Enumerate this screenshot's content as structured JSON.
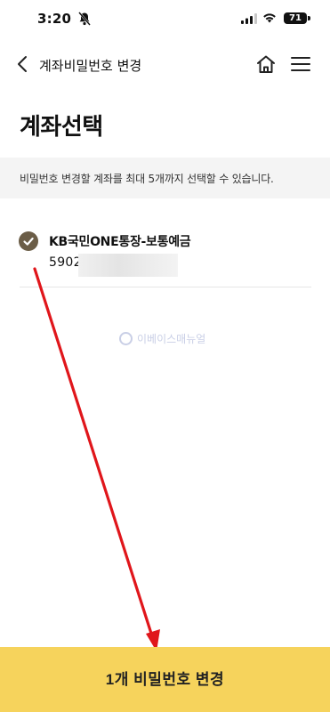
{
  "status_bar": {
    "time": "3:20",
    "battery": "71"
  },
  "header": {
    "title": "계좌비밀번호 변경"
  },
  "page": {
    "title": "계좌선택"
  },
  "notice": "비밀번호 변경할 계좌를 최대 5개까지 선택할 수 있습니다.",
  "accounts": [
    {
      "name": "KB국민ONE통장-보통예금",
      "number": "5902",
      "selected": true
    }
  ],
  "watermark": "이베이스매뉴얼",
  "footer": {
    "button_label": "1개 비밀번호 변경"
  },
  "colors": {
    "accent": "#f6d35c",
    "check": "#6b5d47",
    "annotation": "#e0161b"
  },
  "icons": [
    "bell-slash-icon",
    "signal-icon",
    "wifi-icon",
    "battery-icon",
    "back-chevron-icon",
    "home-icon",
    "menu-icon",
    "check-icon"
  ]
}
